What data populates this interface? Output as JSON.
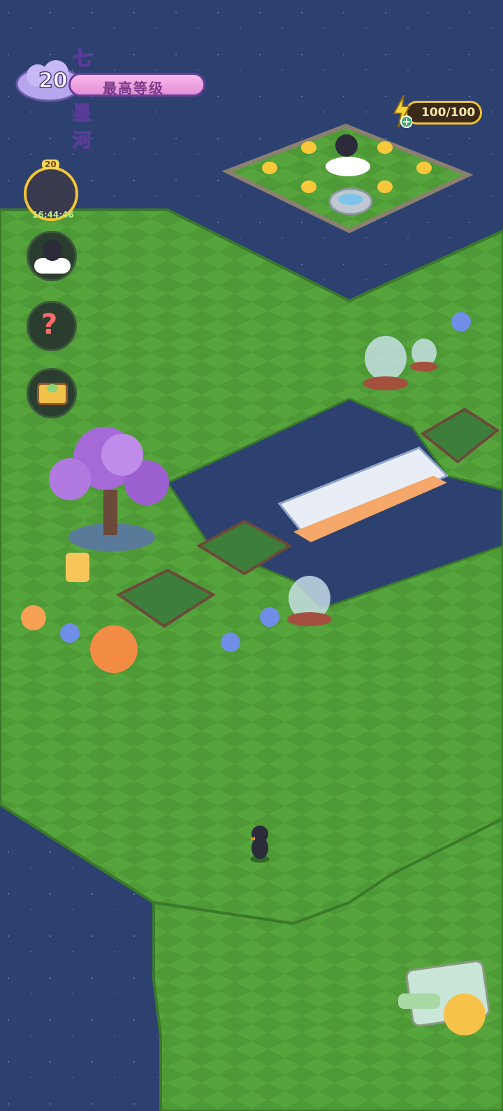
{
  "hud": {
    "area_name": "七夕星河",
    "level": "20",
    "level_status": "最高等级",
    "energy": "100/100",
    "event_level": "20",
    "event_timer": "16:44:46"
  },
  "colors": {
    "water": "#2c4170",
    "grass": "#4e9a37",
    "grass_light": "#5aad3f",
    "grass_edge": "#3b7a2a",
    "accent_pink": "#e58fd6",
    "accent_gold": "#f4c633"
  },
  "icons": [
    "cloud-level-icon",
    "energy-bolt-icon",
    "event-timer-icon",
    "companion-bird-icon",
    "help-icon",
    "treasure-chest-icon",
    "map-telescope-icon"
  ]
}
